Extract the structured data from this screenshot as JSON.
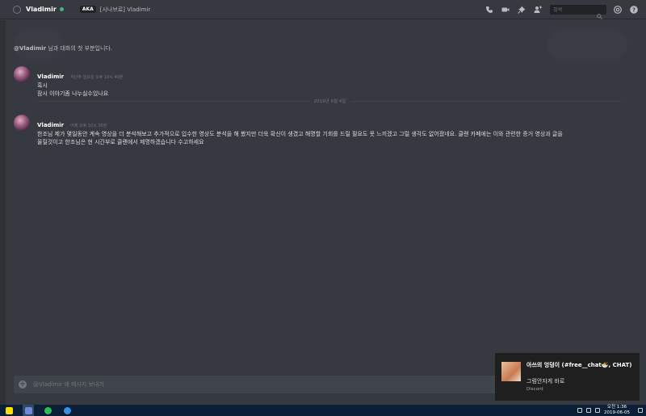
{
  "header": {
    "username": "Vladimir",
    "aka_badge": "AKA",
    "nickname": "[시나브로] Vladimir",
    "search_placeholder": "검색",
    "status_color": "#43b581",
    "icons": [
      "call-icon",
      "video-icon",
      "pin-icon",
      "add-member-icon",
      "search-icon",
      "mention-icon",
      "help-icon"
    ]
  },
  "intro": {
    "mention": "@Vladimir",
    "text": " 님과 대화의 첫 부분입니다."
  },
  "messages": [
    {
      "author": "Vladimir",
      "timestamp": "지난주 일요일 오후 10시 40분",
      "lines": [
        "혹시",
        "잠시 이야기좀 나누실수있나요"
      ]
    },
    {
      "author": "Vladimir",
      "timestamp": "어제 오후 10시 35분",
      "lines": [
        "한조님 제가 몇일동안 계속 영상을 더 분석해보고 추가적으로 입수한 영상도 분석을 해 봤지만 더욱 확신이 생겼고 해명할 기회를 드릴 필요도 못 느끼겠고 그럴 생각도 없어졌네요. 클랜 카페에는 이와 관련한 증거 영상과 글을",
        "올릴것이고 한조님은 현 시간부로 클랜에서 제명하겠습니다 수고하세요"
      ]
    }
  ],
  "date_divider": "2019년 6월 4일",
  "composer": {
    "placeholder": "@Vladimir 에 메시지 보내기"
  },
  "notification": {
    "title": "아쓰의 엉덩이 (#free__chat🍜, CHAT)",
    "body": "그럼안자게 바로",
    "source": "Discord"
  },
  "taskbar": {
    "time": "오전 1:36",
    "date": "2019-06-05"
  }
}
